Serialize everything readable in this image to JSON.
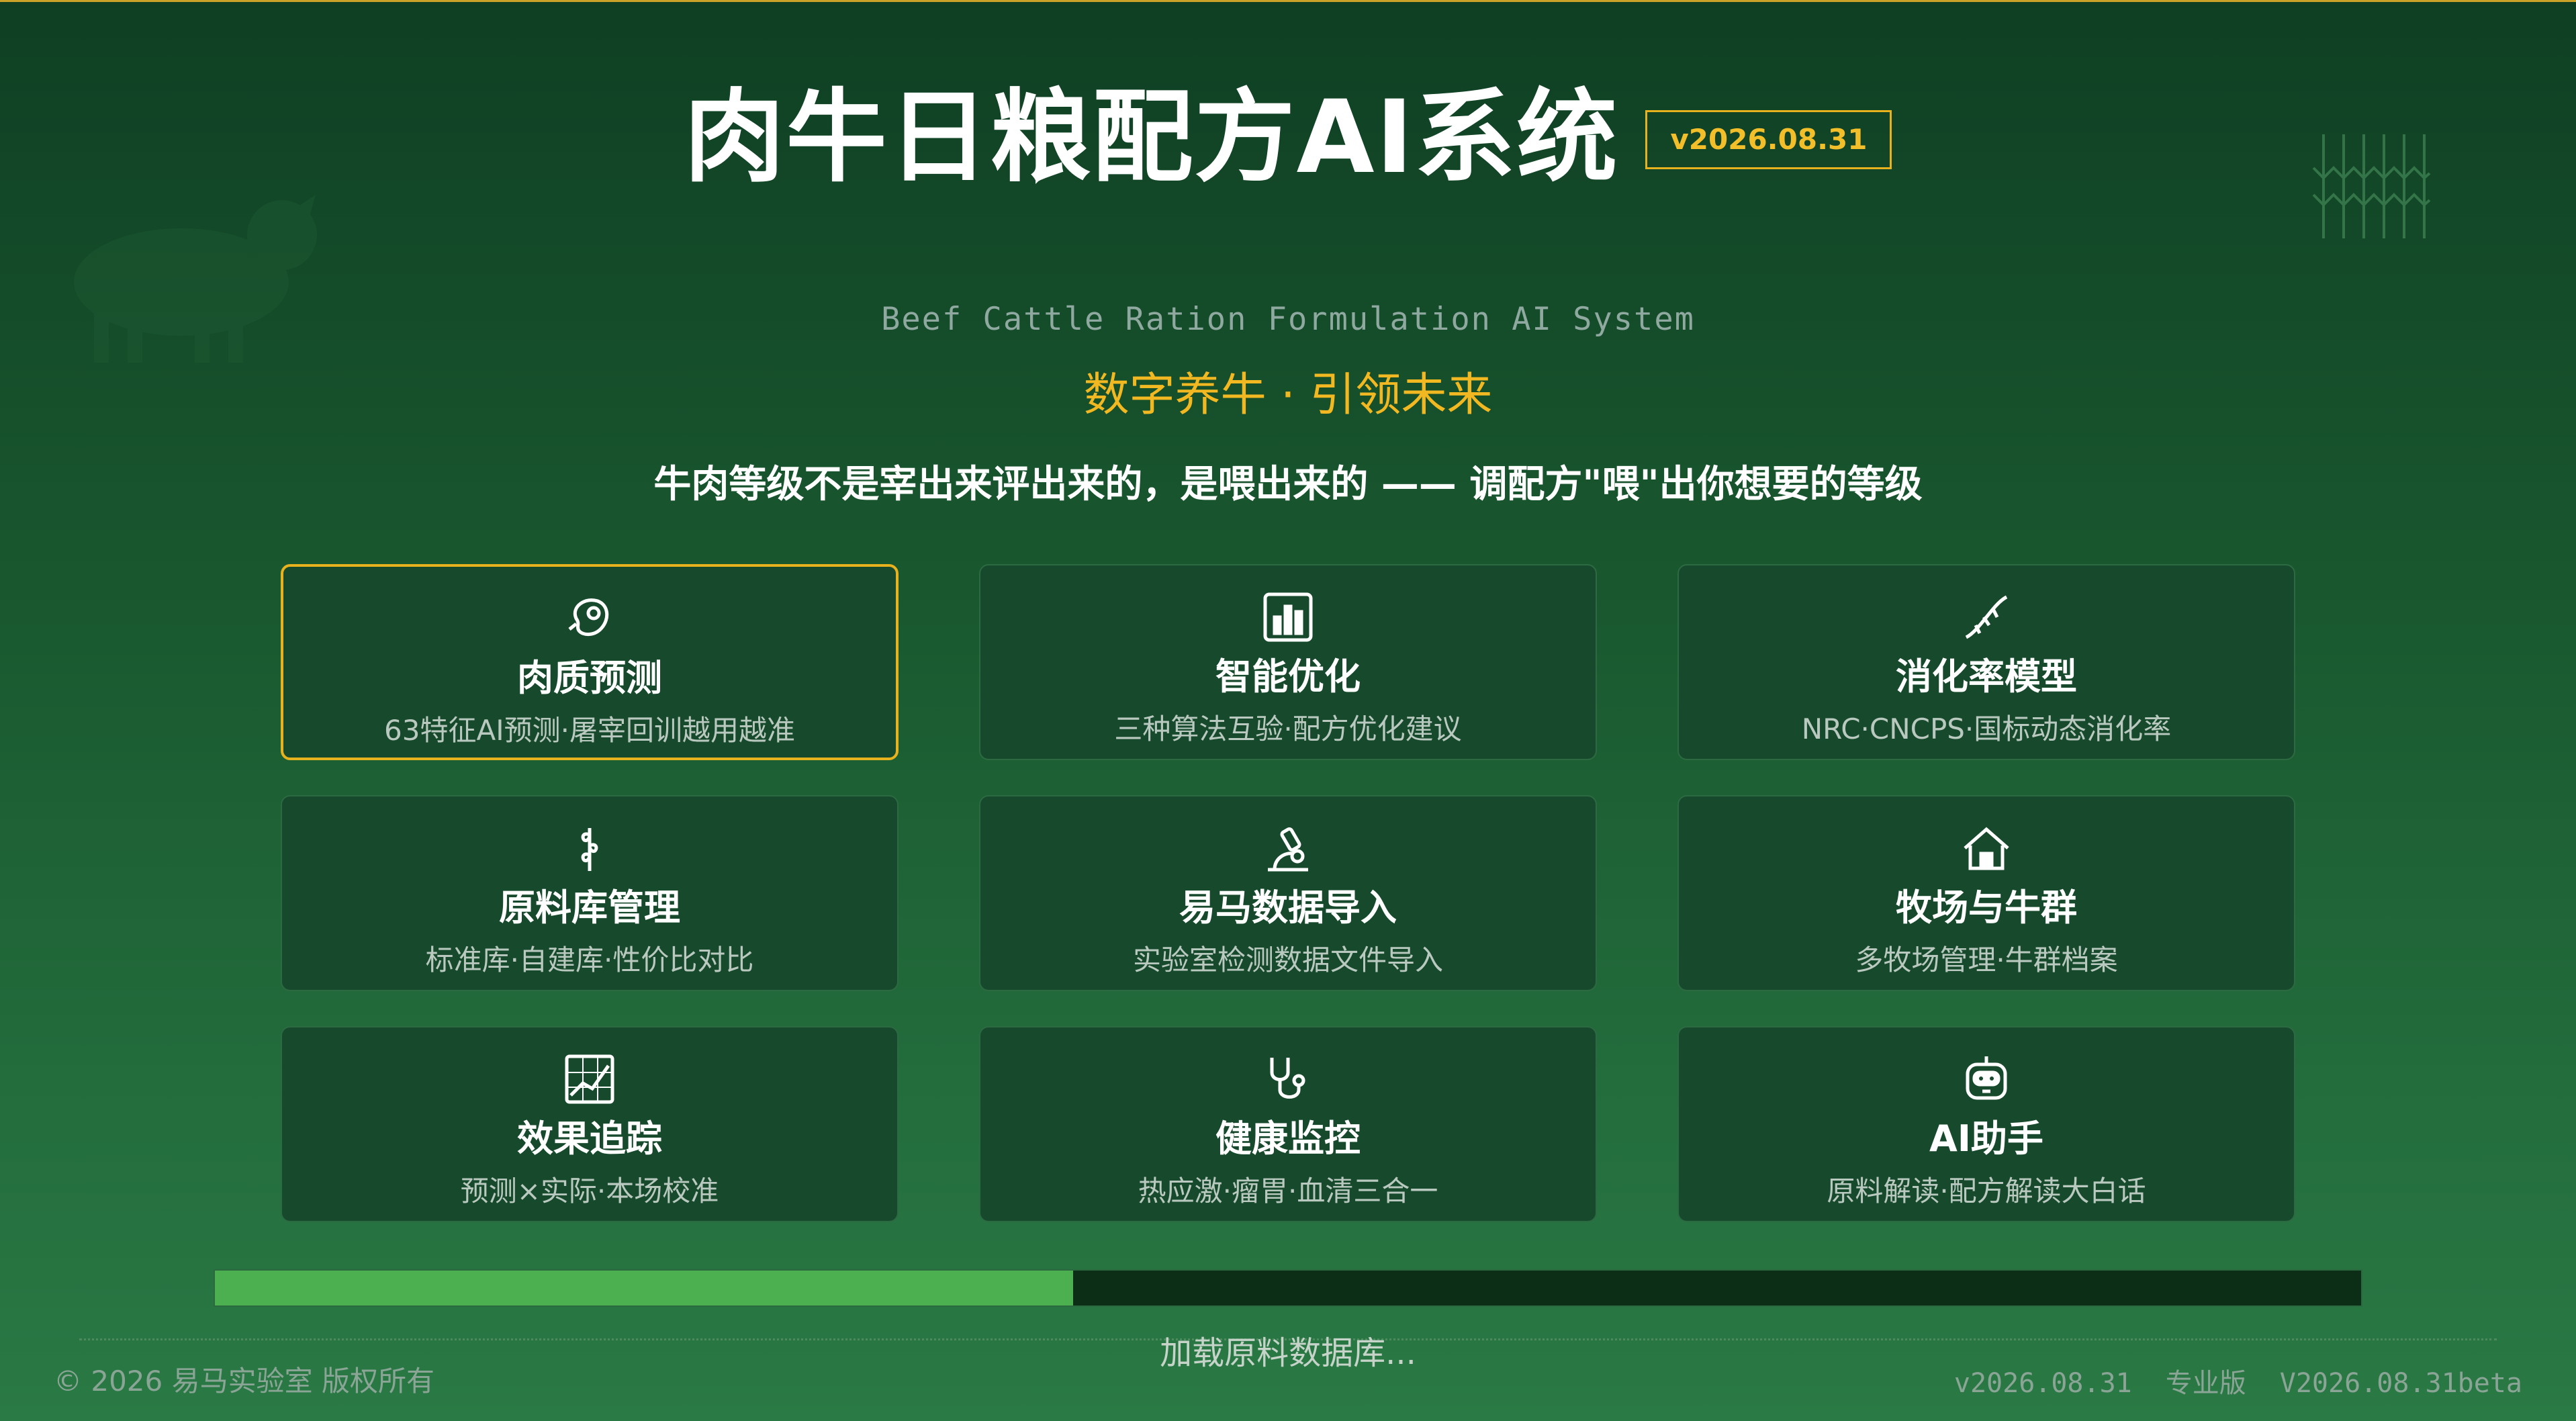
{
  "header": {
    "title": "肉牛日粮配方AI系统",
    "version": "v2026.08.31",
    "subtitle_en": "Beef Cattle Ration Formulation AI System",
    "slogan": "数字养牛 · 引领未来",
    "tagline": "牛肉等级不是宰出来评出来的，是喂出来的 —— 调配方\"喂\"出你想要的等级"
  },
  "modules": [
    {
      "icon": "steak-icon",
      "name": "肉质预测",
      "desc": "63特征AI预测·屠宰回训越用越准",
      "active": true
    },
    {
      "icon": "bar-chart-icon",
      "name": "智能优化",
      "desc": "三种算法互验·配方优化建议",
      "active": false
    },
    {
      "icon": "dna-icon",
      "name": "消化率模型",
      "desc": "NRC·CNCPS·国标动态消化率",
      "active": false
    },
    {
      "icon": "wheat-icon",
      "name": "原料库管理",
      "desc": "标准库·自建库·性价比对比",
      "active": false
    },
    {
      "icon": "microscope-icon",
      "name": "易马数据导入",
      "desc": "实验室检测数据文件导入",
      "active": false
    },
    {
      "icon": "farmhouse-icon",
      "name": "牧场与牛群",
      "desc": "多牧场管理·牛群档案",
      "active": false
    },
    {
      "icon": "line-chart-icon",
      "name": "效果追踪",
      "desc": "预测×实际·本场校准",
      "active": false
    },
    {
      "icon": "stethoscope-icon",
      "name": "健康监控",
      "desc": "热应激·瘤胃·血清三合一",
      "active": false
    },
    {
      "icon": "robot-icon",
      "name": "AI助手",
      "desc": "原料解读·配方解读大白话",
      "active": false
    }
  ],
  "loading": {
    "progress": 0.4,
    "text": "加载原料数据库..."
  },
  "footer": {
    "copyright": "© 2026 易马实验室 版权所有",
    "version": "v2026.08.31",
    "edition": "专业版",
    "build": "V2026.08.31beta"
  },
  "colors": {
    "accent": "#e8b21e",
    "card_bg": "#174a2c",
    "progress_fill": "#4caf50"
  }
}
